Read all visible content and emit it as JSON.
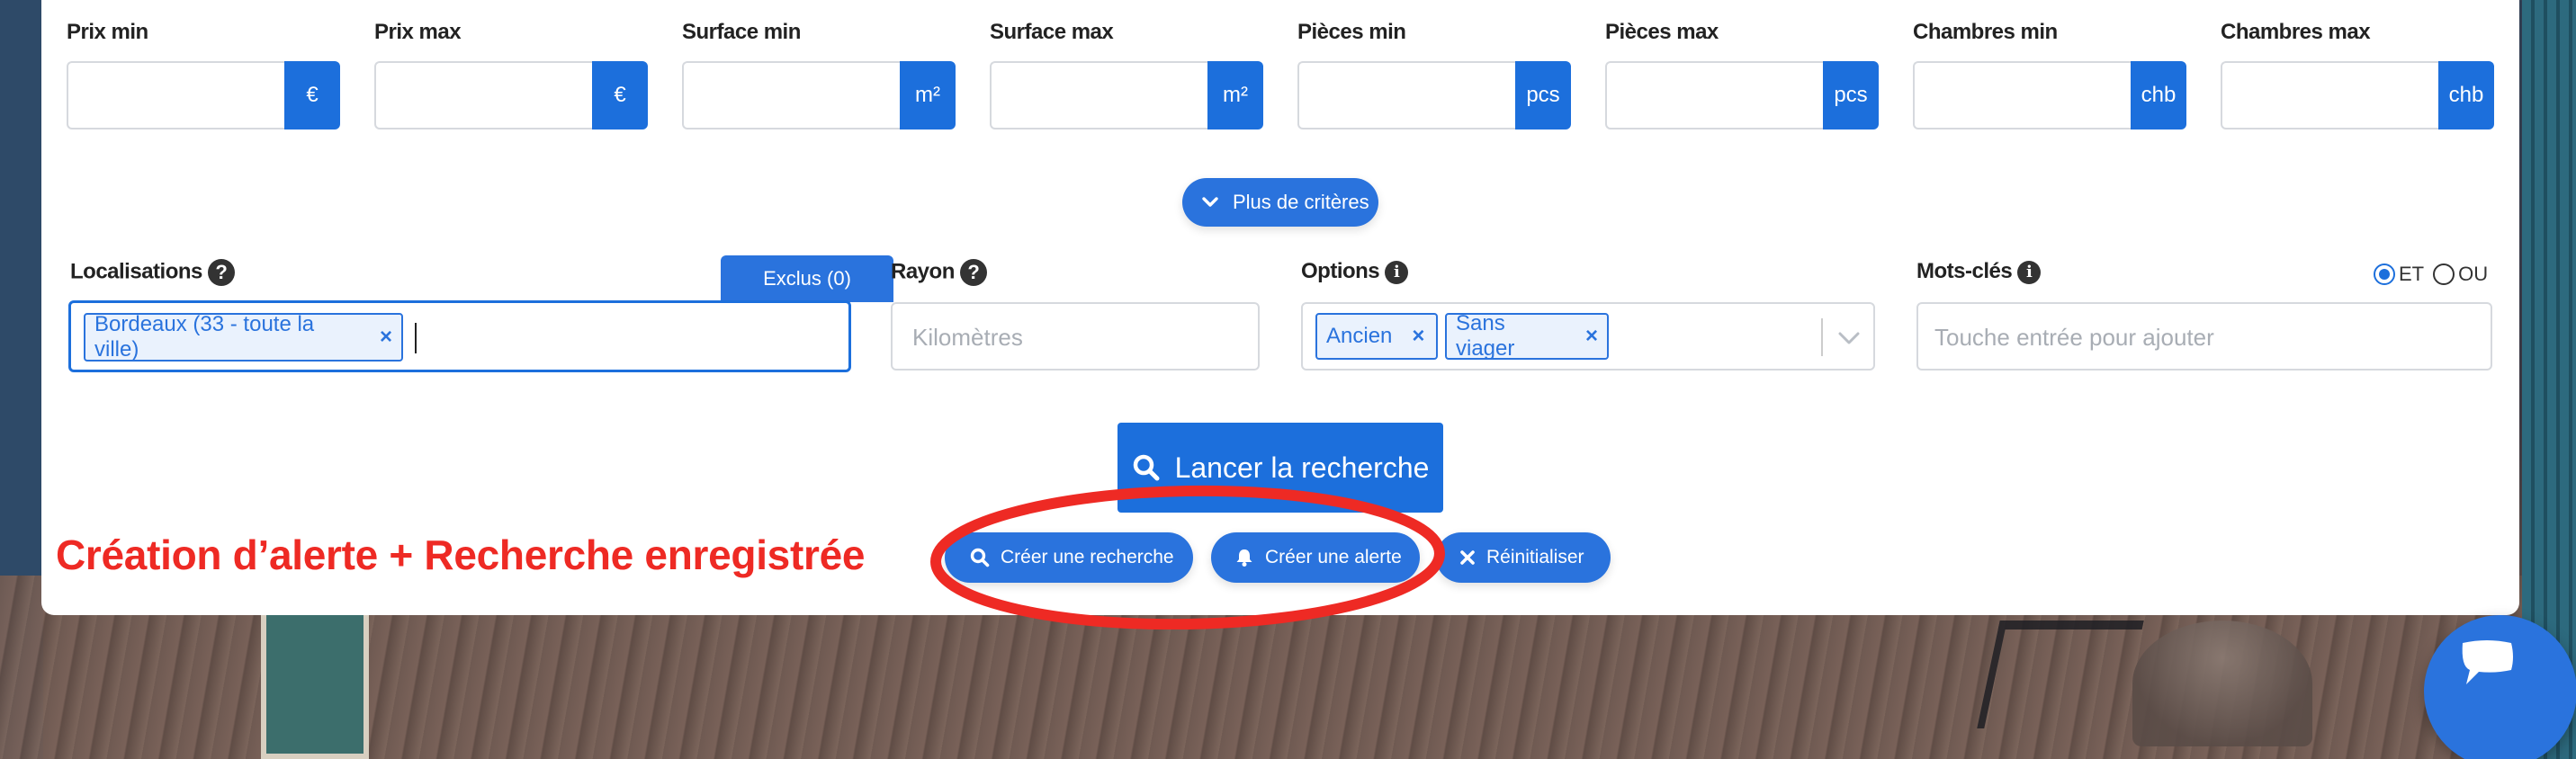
{
  "criteria": [
    {
      "key": "prix_min",
      "label": "Prix min",
      "unit": "€",
      "value": ""
    },
    {
      "key": "prix_max",
      "label": "Prix max",
      "unit": "€",
      "value": ""
    },
    {
      "key": "surface_min",
      "label": "Surface min",
      "unit": "m²",
      "value": ""
    },
    {
      "key": "surface_max",
      "label": "Surface max",
      "unit": "m²",
      "value": ""
    },
    {
      "key": "pieces_min",
      "label": "Pièces min",
      "unit": "pcs",
      "value": ""
    },
    {
      "key": "pieces_max",
      "label": "Pièces max",
      "unit": "pcs",
      "value": ""
    },
    {
      "key": "chambres_min",
      "label": "Chambres min",
      "unit": "chb",
      "value": ""
    },
    {
      "key": "chambres_max",
      "label": "Chambres max",
      "unit": "chb",
      "value": ""
    }
  ],
  "more_criteria_button": "Plus de critères",
  "localisations": {
    "label": "Localisations",
    "excluded_button": "Exclus (0)",
    "tags": [
      "Bordeaux (33 - toute la ville)"
    ]
  },
  "rayon": {
    "label": "Rayon",
    "placeholder": "Kilomètres"
  },
  "options": {
    "label": "Options",
    "tags": [
      "Ancien",
      "Sans viager"
    ]
  },
  "keywords": {
    "label": "Mots-clés",
    "placeholder": "Touche entrée pour ajouter",
    "operator_et": "ET",
    "operator_ou": "OU",
    "selected_operator": "ET"
  },
  "search_button": "Lancer la recherche",
  "actions": {
    "create_search": "Créer une recherche",
    "create_alert": "Créer une alerte",
    "reset": "Réinitialiser"
  },
  "annotation": {
    "text": "Création d’alerte + Recherche enregistrée",
    "color": "#ee2a24"
  },
  "colors": {
    "primary": "#1c6fdc",
    "button": "#2a73dd"
  }
}
